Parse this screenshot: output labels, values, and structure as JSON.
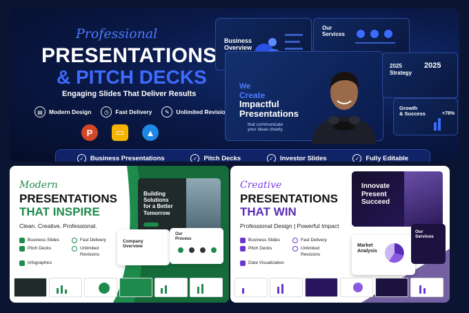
{
  "top": {
    "script_title": "Professional",
    "title_line1": "PRESENTATIONS",
    "title_line2": "& PITCH DECKS",
    "subtitle": "Engaging Slides That Deliver Results",
    "features": [
      "Modern Design",
      "Fast Delivery",
      "Unlimited Revisions"
    ],
    "apps": [
      {
        "name": "powerpoint-icon",
        "glyph": "P",
        "color": "#d24726"
      },
      {
        "name": "google-slides-icon",
        "glyph": "▭",
        "color": "#f4b400"
      },
      {
        "name": "keynote-icon",
        "glyph": "▲",
        "color": "#1e88e5"
      }
    ],
    "bar_items": [
      "Business Presentations",
      "Pitch Decks",
      "Investor Slides",
      "Fully Editable"
    ],
    "mock_business": "Business\nOverview",
    "mock_services": "Our\nServices",
    "mock_we": "We",
    "mock_create": "Create",
    "mock_impactful": "Impactful",
    "mock_presentations": "Presentations",
    "mock_tagline": "that communicate\nyour ideas clearly.",
    "mock_2025a": "2025",
    "mock_strategy": "Strategy",
    "mock_2025b": "2025",
    "mock_growth": "Growth\n& Success",
    "mock_pct": "+78%"
  },
  "left_panel": {
    "script_title": "Modern",
    "title_line1": "PRESENTATIONS",
    "title_line2": "THAT INSPIRE",
    "subtitle": "Clean. Creative. Professional.",
    "items_col1": [
      "Business Slides",
      "Pitch Decks",
      "Infographics"
    ],
    "items_col2": [
      "Fast Delivery",
      "Unlimited\nRevisions"
    ],
    "card_building": "Building\nSolutions\nfor a Better\nTomorrow",
    "card_company": "Company\nOverview",
    "card_process": "Our\nProcess",
    "accent": "#1e8a4c"
  },
  "right_panel": {
    "script_title": "Creative",
    "title_line1": "PRESENTATIONS",
    "title_line2": "THAT WIN",
    "subtitle": "Professional Design | Powerful Impact",
    "items_col1": [
      "Business Slides",
      "Pitch Decks",
      "Data Visualization"
    ],
    "items_col2": [
      "Fast Delivery",
      "Unlimited\nRevisions"
    ],
    "card_innovate": "Innovate\nPresent\nSucceed",
    "card_market": "Market\nAnalysis",
    "card_services": "Our\nServices",
    "accent": "#5a2bb5"
  }
}
